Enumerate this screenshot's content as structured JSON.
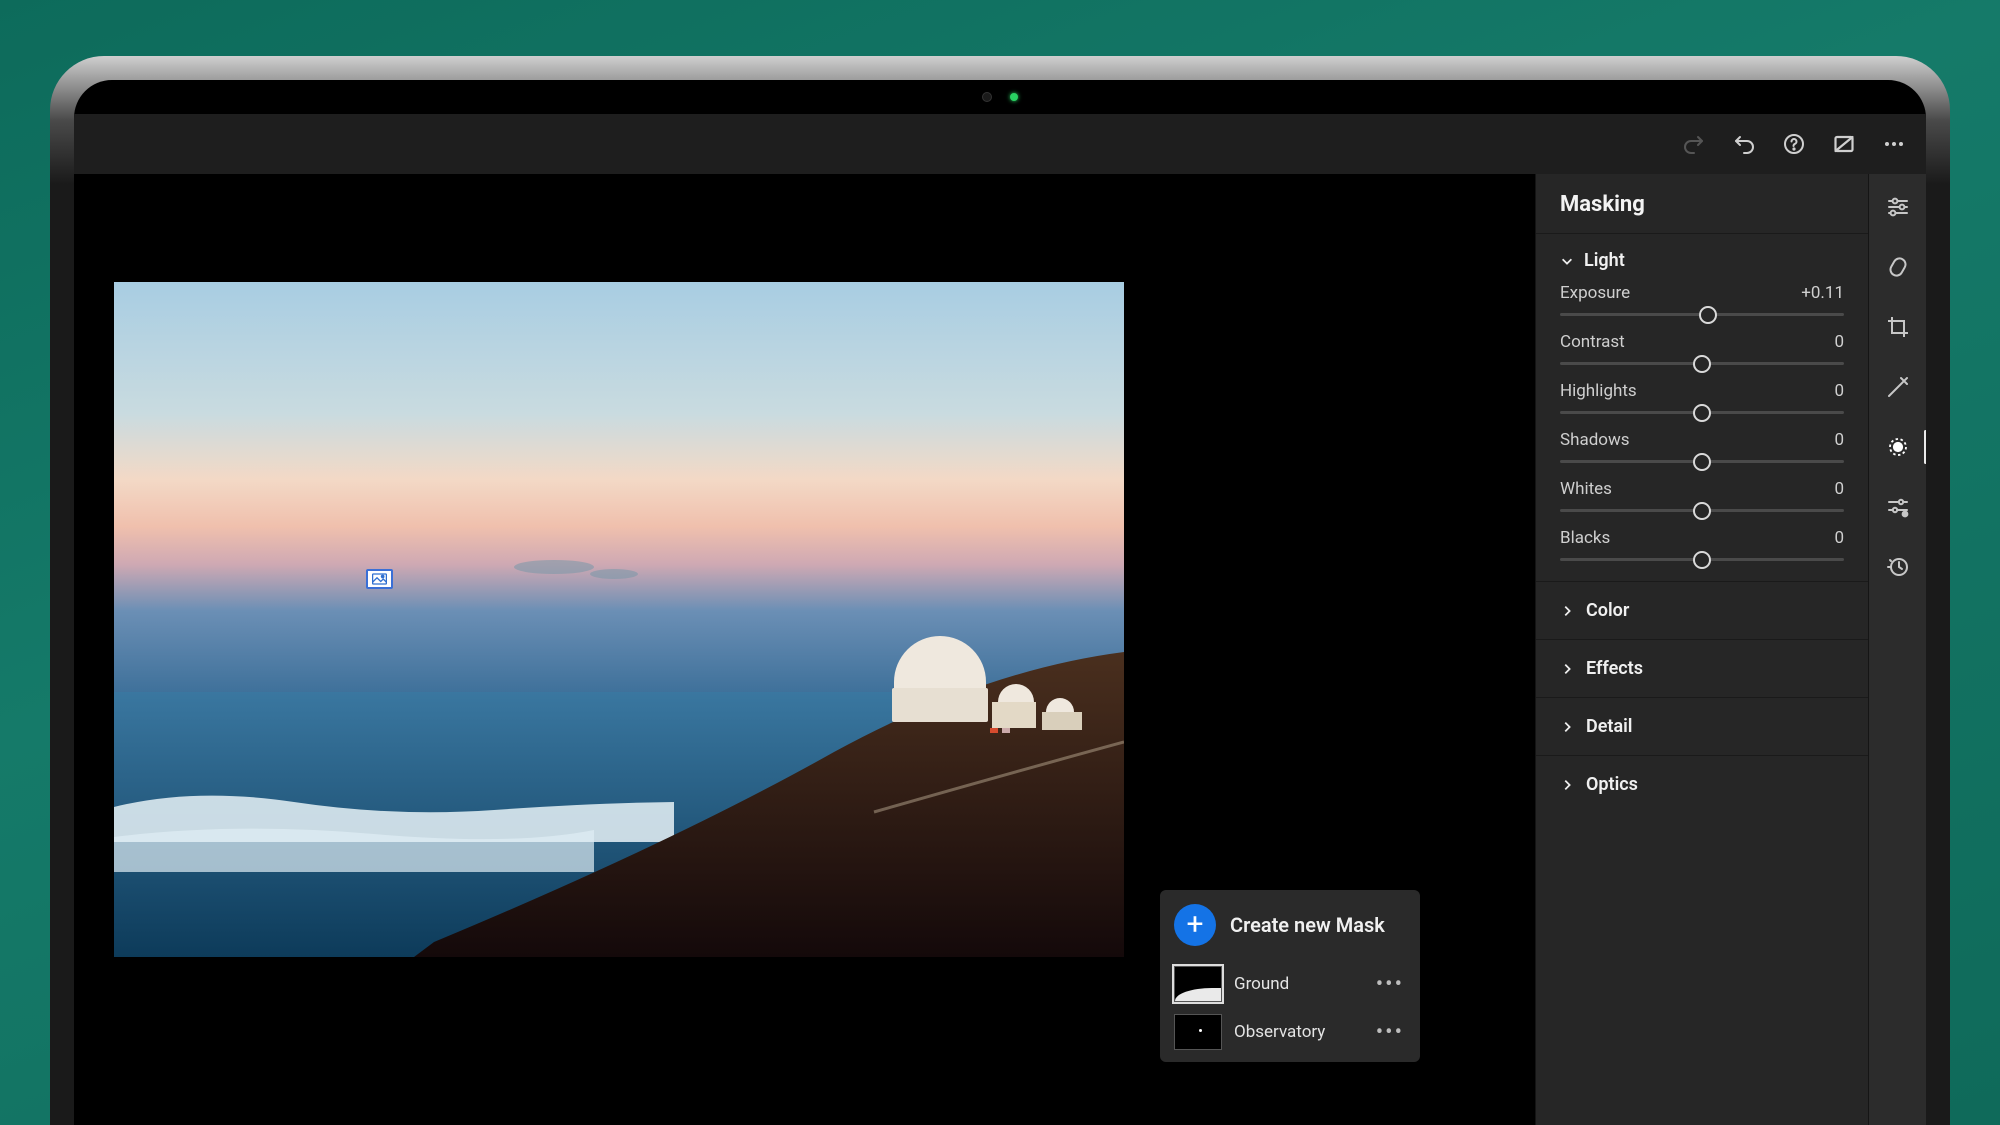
{
  "panel": {
    "title": "Masking",
    "light": {
      "label": "Light",
      "sliders": [
        {
          "name": "Exposure",
          "value": "+0.11",
          "pos": 52
        },
        {
          "name": "Contrast",
          "value": "0",
          "pos": 50
        },
        {
          "name": "Highlights",
          "value": "0",
          "pos": 50
        },
        {
          "name": "Shadows",
          "value": "0",
          "pos": 50
        },
        {
          "name": "Whites",
          "value": "0",
          "pos": 50
        },
        {
          "name": "Blacks",
          "value": "0",
          "pos": 50
        }
      ]
    },
    "collapsed": [
      {
        "label": "Color"
      },
      {
        "label": "Effects"
      },
      {
        "label": "Detail"
      },
      {
        "label": "Optics"
      }
    ]
  },
  "mask_popup": {
    "create_label": "Create new Mask",
    "items": [
      {
        "label": "Ground",
        "selected": true
      },
      {
        "label": "Observatory",
        "selected": false
      }
    ]
  },
  "topbar": {
    "icons": [
      "redo",
      "undo",
      "help",
      "compare",
      "more"
    ]
  },
  "tool_rail": {
    "tools": [
      "adjust",
      "heal",
      "crop",
      "brush",
      "mask",
      "presets",
      "history"
    ],
    "active": "mask"
  }
}
